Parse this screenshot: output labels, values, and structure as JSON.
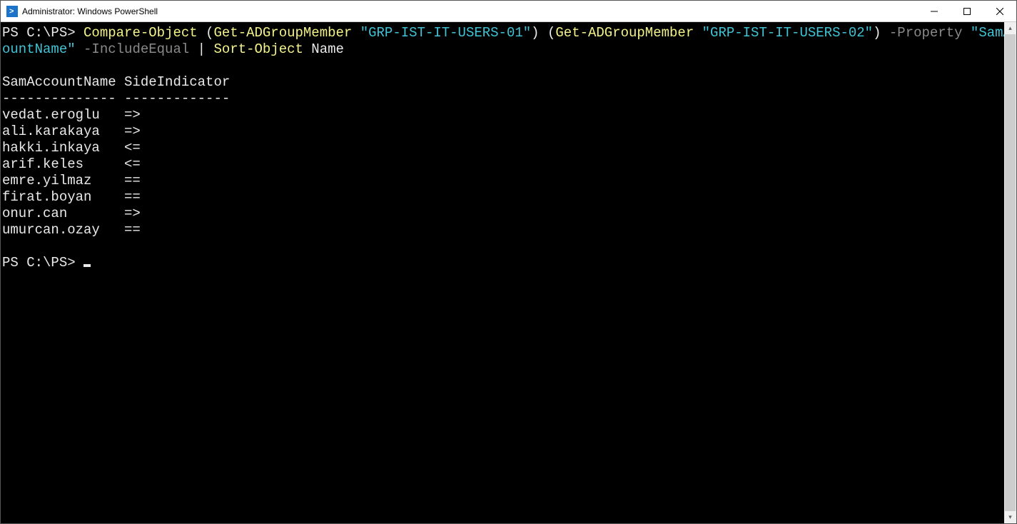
{
  "titlebar": {
    "title": "Administrator: Windows PowerShell"
  },
  "prompt": "PS C:\\PS>",
  "command": {
    "cmd1": "Compare-Object",
    "paren1_open": " (",
    "cmd2": "Get-ADGroupMember",
    "arg1": " \"GRP-IST-IT-USERS-01\"",
    "paren1_close": ") (",
    "cmd3": "Get-ADGroupMember",
    "arg2": " \"GRP-IST-IT-USERS-02\"",
    "paren2_close": ") ",
    "param1": "-Property",
    "arg3_part1": " \"SamAcc",
    "arg3_part2": "ountName\"",
    "param2": " -IncludeEqual",
    "pipe": " | ",
    "cmd4": "Sort-Object",
    "arg4": " Name"
  },
  "output": {
    "header": "SamAccountName SideIndicator",
    "divider": "-------------- -------------",
    "rows": [
      {
        "name": "vedat.eroglu",
        "ind": "=>"
      },
      {
        "name": "ali.karakaya",
        "ind": "=>"
      },
      {
        "name": "hakki.inkaya",
        "ind": "<="
      },
      {
        "name": "arif.keles",
        "ind": "<="
      },
      {
        "name": "emre.yilmaz",
        "ind": "=="
      },
      {
        "name": "firat.boyan",
        "ind": "=="
      },
      {
        "name": "onur.can",
        "ind": "=>"
      },
      {
        "name": "umurcan.ozay",
        "ind": "=="
      }
    ]
  }
}
